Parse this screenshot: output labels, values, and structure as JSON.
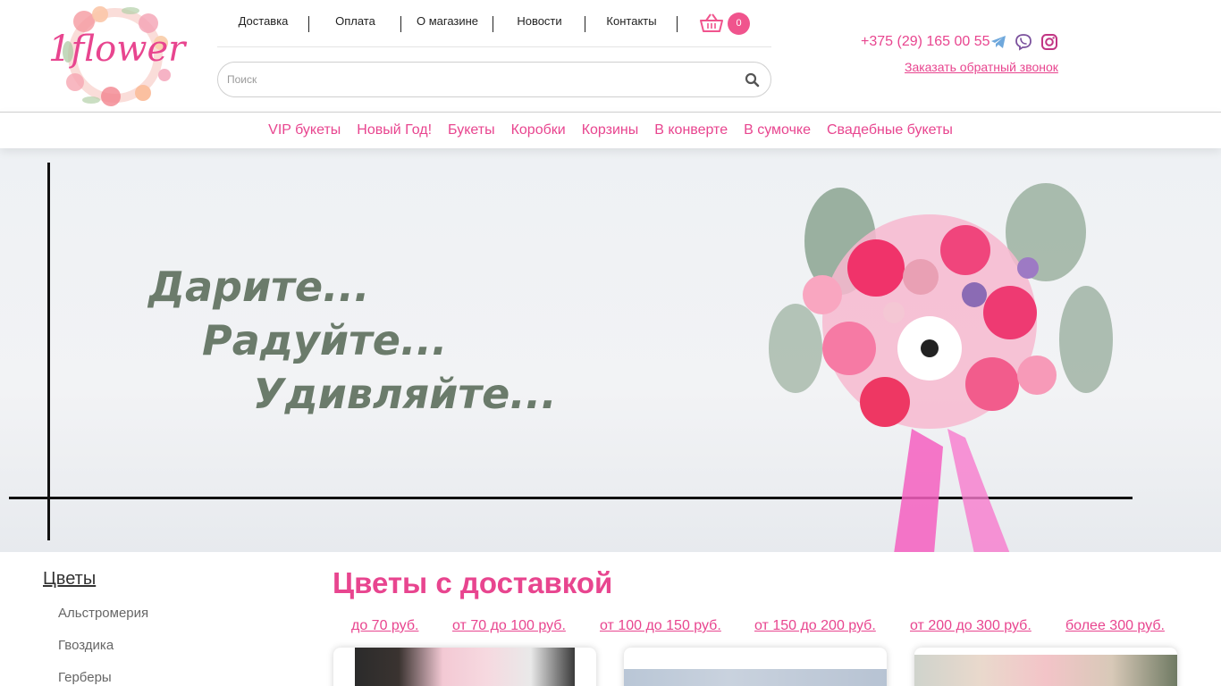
{
  "logo": {
    "text": "1flower"
  },
  "topnav": {
    "items": [
      {
        "label": "Доставка"
      },
      {
        "label": "Оплата"
      },
      {
        "label": "О магазине"
      },
      {
        "label": "Новости"
      },
      {
        "label": "Контакты"
      }
    ]
  },
  "cart": {
    "count": "0",
    "icon": "basket-icon"
  },
  "search": {
    "placeholder": "Поиск",
    "icon": "search-icon"
  },
  "contacts": {
    "phone": "+375 (29) 165 00 55",
    "callback": "Заказать обратный звонок",
    "social": [
      "telegram-icon",
      "viber-icon",
      "instagram-icon"
    ]
  },
  "categories": [
    {
      "label": "VIP букеты"
    },
    {
      "label": "Новый Год!"
    },
    {
      "label": "Букеты"
    },
    {
      "label": "Коробки"
    },
    {
      "label": "Корзины"
    },
    {
      "label": "В конверте"
    },
    {
      "label": "В сумочке"
    },
    {
      "label": "Свадебные букеты"
    }
  ],
  "hero": {
    "lines": [
      "Дарите...",
      "Радуйте...",
      "Удивляйте..."
    ]
  },
  "sidebar": {
    "title": "Цветы",
    "items": [
      {
        "label": "Альстромерия"
      },
      {
        "label": "Гвоздика"
      },
      {
        "label": "Герберы"
      }
    ]
  },
  "main": {
    "title": "Цветы с доставкой",
    "price_filters": [
      {
        "label": "до 70 руб."
      },
      {
        "label": "от 70 до 100 руб."
      },
      {
        "label": "от 100 до 150 руб."
      },
      {
        "label": "от 150 до 200 руб."
      },
      {
        "label": "от 200 до 300 руб."
      },
      {
        "label": "более 300 руб."
      }
    ]
  },
  "colors": {
    "accent": "#e8458f",
    "badge": "#f0548d"
  }
}
